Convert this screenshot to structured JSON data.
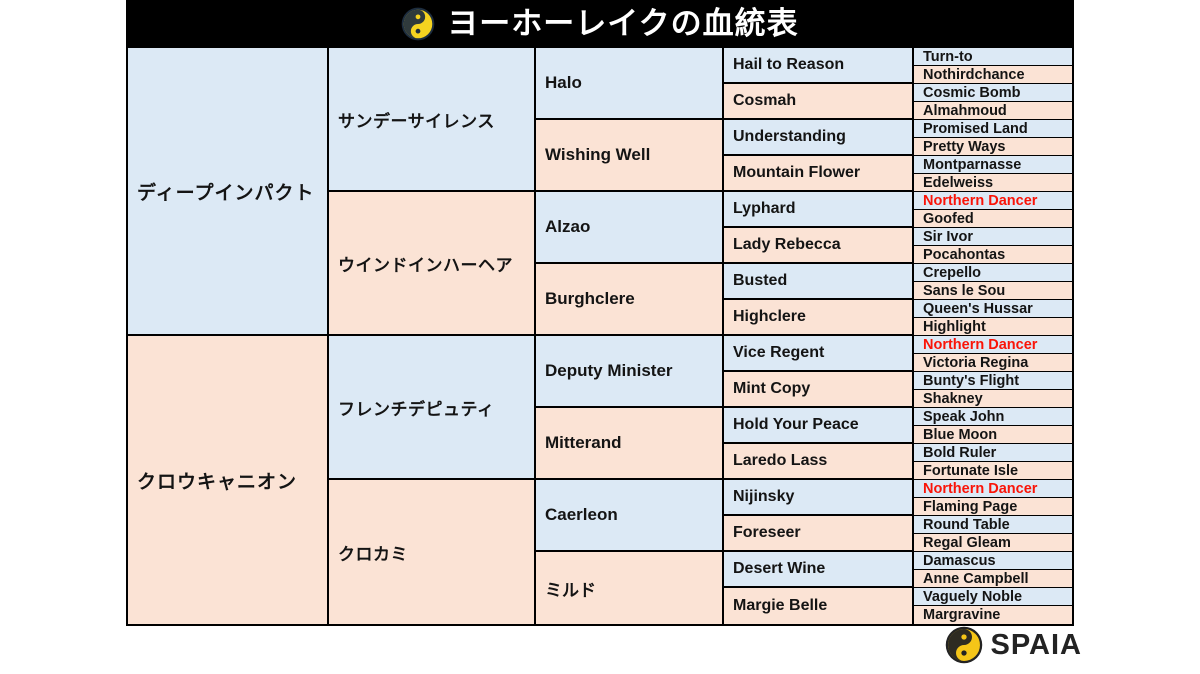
{
  "header": {
    "title": "ヨーホーレイクの血統表",
    "logo_icon": "spaia-swirl-icon",
    "background_color": "#000000",
    "text_color": "#ffffff"
  },
  "colors": {
    "sire_blue": "#dce9f5",
    "dam_pink": "#fbe3d5",
    "highlight_red": "#fa1408",
    "border": "#000000"
  },
  "pedigree": {
    "generation_1": [
      {
        "name": "ディープインパクト",
        "shade": "blue"
      },
      {
        "name": "クロウキャニオン",
        "shade": "pink"
      }
    ],
    "generation_2": [
      {
        "name": "サンデーサイレンス",
        "shade": "blue"
      },
      {
        "name": "ウインドインハーヘア",
        "shade": "pink"
      },
      {
        "name": "フレンチデピュティ",
        "shade": "blue"
      },
      {
        "name": "クロカミ",
        "shade": "pink"
      }
    ],
    "generation_3": [
      {
        "name": "Halo",
        "shade": "blue"
      },
      {
        "name": "Wishing Well",
        "shade": "pink"
      },
      {
        "name": "Alzao",
        "shade": "blue"
      },
      {
        "name": "Burghclere",
        "shade": "pink"
      },
      {
        "name": "Deputy Minister",
        "shade": "blue"
      },
      {
        "name": "Mitterand",
        "shade": "pink"
      },
      {
        "name": "Caerleon",
        "shade": "blue"
      },
      {
        "name": "ミルド",
        "shade": "pink"
      }
    ],
    "generation_4": [
      {
        "name": "Hail to Reason",
        "shade": "blue"
      },
      {
        "name": "Cosmah",
        "shade": "pink"
      },
      {
        "name": "Understanding",
        "shade": "blue"
      },
      {
        "name": "Mountain Flower",
        "shade": "pink"
      },
      {
        "name": "Lyphard",
        "shade": "blue"
      },
      {
        "name": "Lady Rebecca",
        "shade": "pink"
      },
      {
        "name": "Busted",
        "shade": "blue"
      },
      {
        "name": "Highclere",
        "shade": "pink"
      },
      {
        "name": "Vice Regent",
        "shade": "blue"
      },
      {
        "name": "Mint Copy",
        "shade": "pink"
      },
      {
        "name": "Hold Your Peace",
        "shade": "blue"
      },
      {
        "name": "Laredo Lass",
        "shade": "pink"
      },
      {
        "name": "Nijinsky",
        "shade": "blue"
      },
      {
        "name": "Foreseer",
        "shade": "pink"
      },
      {
        "name": "Desert Wine",
        "shade": "blue"
      },
      {
        "name": "Margie Belle",
        "shade": "pink"
      }
    ],
    "generation_5": [
      {
        "name": "Turn-to",
        "shade": "blue",
        "highlight": false
      },
      {
        "name": "Nothirdchance",
        "shade": "pink",
        "highlight": false
      },
      {
        "name": "Cosmic Bomb",
        "shade": "blue",
        "highlight": false
      },
      {
        "name": "Almahmoud",
        "shade": "pink",
        "highlight": false
      },
      {
        "name": "Promised Land",
        "shade": "blue",
        "highlight": false
      },
      {
        "name": "Pretty Ways",
        "shade": "pink",
        "highlight": false
      },
      {
        "name": "Montparnasse",
        "shade": "blue",
        "highlight": false
      },
      {
        "name": "Edelweiss",
        "shade": "pink",
        "highlight": false
      },
      {
        "name": "Northern Dancer",
        "shade": "blue",
        "highlight": true
      },
      {
        "name": "Goofed",
        "shade": "pink",
        "highlight": false
      },
      {
        "name": "Sir Ivor",
        "shade": "blue",
        "highlight": false
      },
      {
        "name": "Pocahontas",
        "shade": "pink",
        "highlight": false
      },
      {
        "name": "Crepello",
        "shade": "blue",
        "highlight": false
      },
      {
        "name": "Sans le Sou",
        "shade": "pink",
        "highlight": false
      },
      {
        "name": "Queen's Hussar",
        "shade": "blue",
        "highlight": false
      },
      {
        "name": "Highlight",
        "shade": "pink",
        "highlight": false
      },
      {
        "name": "Northern Dancer",
        "shade": "blue",
        "highlight": true
      },
      {
        "name": "Victoria Regina",
        "shade": "pink",
        "highlight": false
      },
      {
        "name": "Bunty's Flight",
        "shade": "blue",
        "highlight": false
      },
      {
        "name": "Shakney",
        "shade": "pink",
        "highlight": false
      },
      {
        "name": "Speak John",
        "shade": "blue",
        "highlight": false
      },
      {
        "name": "Blue Moon",
        "shade": "pink",
        "highlight": false
      },
      {
        "name": "Bold Ruler",
        "shade": "blue",
        "highlight": false
      },
      {
        "name": "Fortunate Isle",
        "shade": "pink",
        "highlight": false
      },
      {
        "name": "Northern Dancer",
        "shade": "blue",
        "highlight": true
      },
      {
        "name": "Flaming Page",
        "shade": "pink",
        "highlight": false
      },
      {
        "name": "Round Table",
        "shade": "blue",
        "highlight": false
      },
      {
        "name": "Regal Gleam",
        "shade": "pink",
        "highlight": false
      },
      {
        "name": "Damascus",
        "shade": "blue",
        "highlight": false
      },
      {
        "name": "Anne Campbell",
        "shade": "pink",
        "highlight": false
      },
      {
        "name": "Vaguely Noble",
        "shade": "blue",
        "highlight": false
      },
      {
        "name": "Margravine",
        "shade": "pink",
        "highlight": false
      }
    ]
  },
  "footer": {
    "brand": "SPAIA",
    "logo_icon": "spaia-swirl-icon"
  }
}
